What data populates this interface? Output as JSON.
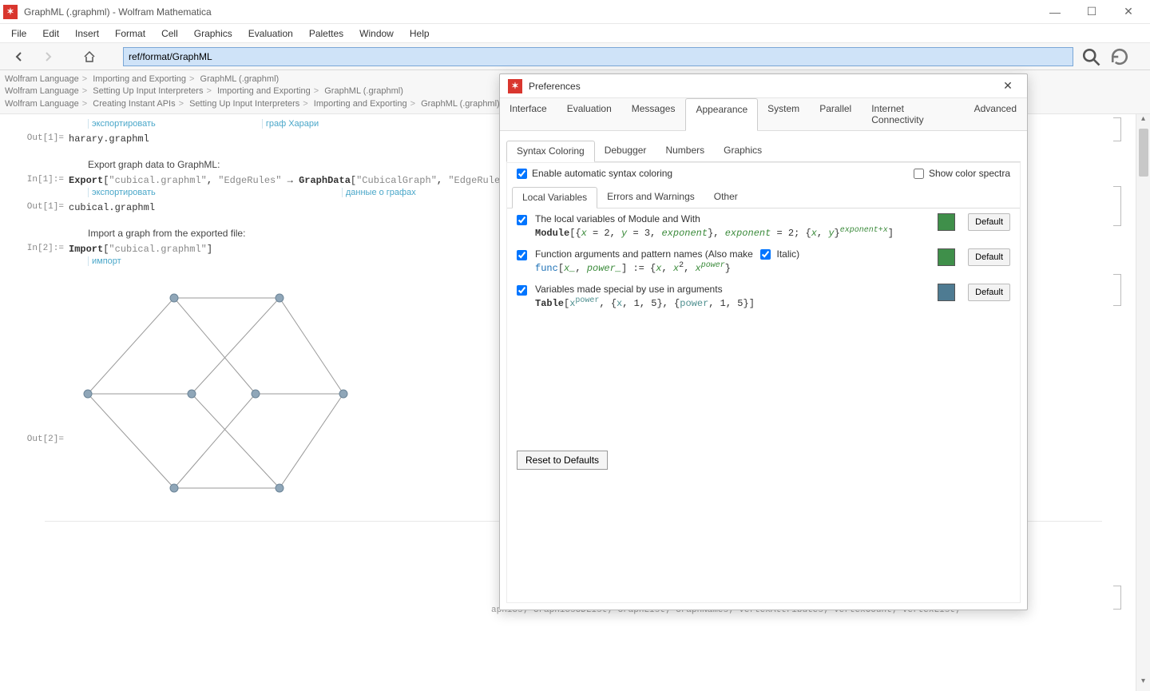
{
  "window": {
    "title": "GraphML (.graphml) - Wolfram Mathematica"
  },
  "menu": [
    "File",
    "Edit",
    "Insert",
    "Format",
    "Cell",
    "Graphics",
    "Evaluation",
    "Palettes",
    "Window",
    "Help"
  ],
  "toolbar": {
    "address": "ref/format/GraphML"
  },
  "breadcrumbs": [
    [
      "Wolfram Language",
      "Importing and Exporting",
      "GraphML (.graphml)"
    ],
    [
      "Wolfram Language",
      "Setting Up Input Interpreters",
      "Importing and Exporting",
      "GraphML (.graphml)"
    ],
    [
      "Wolfram Language",
      "Creating Instant APIs",
      "Setting Up Input Interpreters",
      "Importing and Exporting",
      "GraphML (.graphml)"
    ]
  ],
  "notebook": {
    "hints1": {
      "a": "экспортировать",
      "b": "граф Харари"
    },
    "out1_label": "Out[1]=",
    "out1_text": "harary.graphml",
    "section1": "Export graph data to GraphML:",
    "in1_label": "In[1]:=",
    "in1_code": "Export[\"cubical.graphml\", \"EdgeRules\" → GraphData[\"CubicalGraph\", \"EdgeRules\"],",
    "hints2": {
      "a": "экспортировать",
      "b": "данные о графах"
    },
    "out1b_label": "Out[1]=",
    "out1b_text": "cubical.graphml",
    "section2": "Import a graph from the exported file:",
    "in2_label": "In[2]:=",
    "in2_code": "Import[\"cubical.graphml\"]",
    "hints3": {
      "a": "импорт"
    },
    "out2_label": "Out[2]="
  },
  "prefs": {
    "title": "Preferences",
    "tabs": [
      "Interface",
      "Evaluation",
      "Messages",
      "Appearance",
      "System",
      "Parallel",
      "Internet Connectivity",
      "Advanced"
    ],
    "active_tab": "Appearance",
    "sub_tabs": [
      "Syntax Coloring",
      "Debugger",
      "Numbers",
      "Graphics"
    ],
    "active_sub": "Syntax Coloring",
    "enable_label": "Enable automatic syntax coloring",
    "spectra_label": "Show color spectra",
    "sub_tabs2": [
      "Local Variables",
      "Errors and Warnings",
      "Other"
    ],
    "active_sub2": "Local Variables",
    "opt1": {
      "label": "The local variables of Module and With",
      "example_pre": "Module[{",
      "example_body": "x = 2, y = 3, exponent}, exponent = 2; {x, y}",
      "example_sup": "exponent+x",
      "example_post": "]"
    },
    "opt2": {
      "label": "Function arguments and pattern names  (Also make",
      "italic_label": "Italic)",
      "example": "func[x_, power_] := {x, x², xᵖᵒʷᵉʳ}"
    },
    "opt3": {
      "label": "Variables made special by use in arguments",
      "example": "Table[xᵖᵒʷᵉʳ, {x, 1, 5}, {power, 1, 5}]"
    },
    "default_btn": "Default",
    "reset_btn": "Reset to Defaults",
    "swatches": {
      "c1": "#3f8f4a",
      "c2": "#3f8f4a",
      "c3": "#4e7b92"
    }
  },
  "footer_text": "aphics; Graphics3DList; GraphList; GraphNames; VertexAttributes; VertexCount; VertexList;"
}
